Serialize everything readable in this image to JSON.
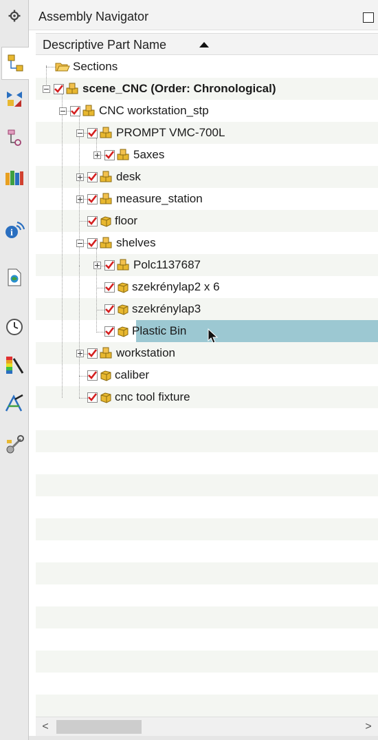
{
  "navigator": {
    "title": "Assembly Navigator",
    "column_header": "Descriptive Part Name",
    "sort_direction": "ascending"
  },
  "toolbar": {
    "icons": [
      "gear-icon",
      "assembly-navigator-icon",
      "constraint-navigator-icon",
      "part-navigator-icon",
      "reuse-library-icon",
      "hd3d-tools-icon",
      "web-browser-icon",
      "history-icon",
      "visual-effects-icon",
      "process-studio-icon",
      "roles-icon"
    ]
  },
  "tree": {
    "sections": "Sections",
    "scene": "scene_CNC (Order: Chronological)",
    "workstation_stp": "CNC workstation_stp",
    "prompt": "PROMPT VMC-700L",
    "axes": "5axes",
    "desk": "desk",
    "measure_station": "measure_station",
    "floor": "floor",
    "shelves": "shelves",
    "polc": "Polc1137687",
    "szekrenylap2": "szekrénylap2 x 6",
    "szekrenylap3": "szekrénylap3",
    "plastic_bin": "Plastic Bin",
    "workstation": "workstation",
    "caliber": "caliber",
    "cnc_tool_fixture": "cnc tool fixture"
  },
  "colors": {
    "selection": "#9cc8d2",
    "check": "#d42020",
    "part": "#e8b830",
    "folder": "#f2c14e"
  },
  "scrollbar": {
    "left_arrow": "<",
    "right_arrow": ">"
  }
}
